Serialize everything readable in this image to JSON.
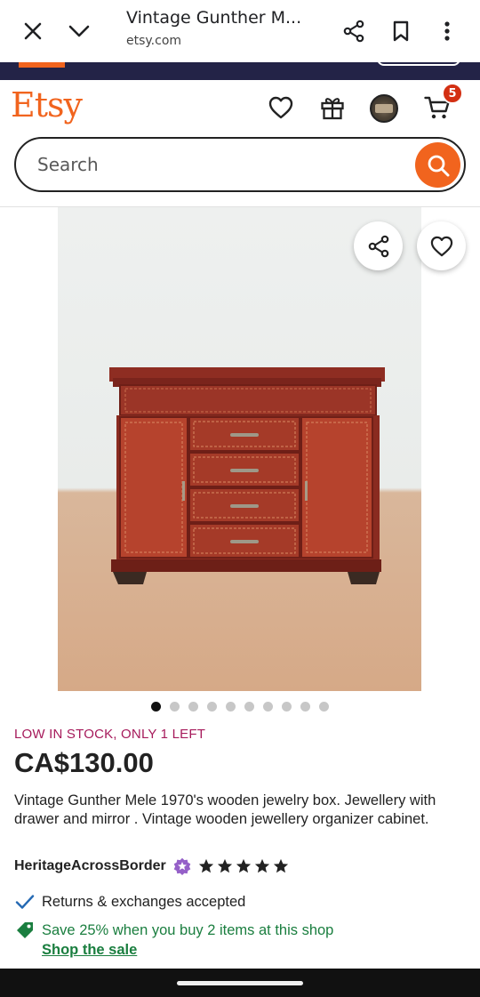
{
  "browser": {
    "title": "Vintage Gunther M...",
    "url": "etsy.com"
  },
  "header": {
    "logo": "Etsy",
    "cart_count": "5"
  },
  "search": {
    "placeholder": "Search"
  },
  "gallery": {
    "image_count": 10,
    "active_index": 0
  },
  "product": {
    "stock_notice": "LOW IN STOCK, ONLY 1 LEFT",
    "price": "CA$130.00",
    "description": "Vintage Gunther Mele 1970's wooden jewelry box. Jewellery with drawer and mirror . Vintage wooden jewellery organizer cabinet.",
    "seller": "HeritageAcrossBorder",
    "rating": 5
  },
  "perks": {
    "returns": "Returns & exchanges accepted",
    "sale": "Save 25% when you buy 2 items at this shop",
    "shop_sale_link": "Shop the sale"
  },
  "colors": {
    "brand_orange": "#f1641e",
    "stock_text": "#a61a5b",
    "sale_green": "#1a7e3f",
    "badge_red": "#d32f12"
  },
  "icons": [
    "close-icon",
    "chevron-down-icon",
    "share-icon",
    "bookmark-icon",
    "more-vert-icon",
    "heart-icon",
    "gift-icon",
    "cart-icon",
    "search-icon",
    "checkmark-icon",
    "tag-icon",
    "star-seller-icon",
    "star-icon"
  ]
}
